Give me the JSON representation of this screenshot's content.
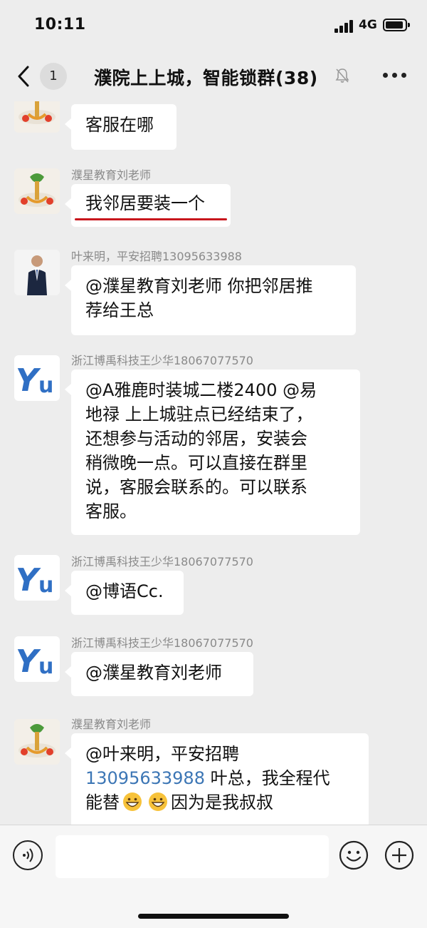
{
  "status_bar": {
    "time": "10:11",
    "network": "4G"
  },
  "nav": {
    "back_badge": "1",
    "title": "濮院上上城，智能锁群(38)",
    "icons": {
      "back": "chevron-left-icon",
      "mute": "bell-mute-icon",
      "more": "more-dots-icon"
    }
  },
  "messages": [
    {
      "sender": "",
      "text": "客服在哪",
      "avatar": "food-plate-avatar"
    },
    {
      "sender": "濮星教育刘老师",
      "text": "我邻居要装一个",
      "avatar": "food-plate-avatar",
      "underline_color": "#c8161d"
    },
    {
      "sender": "叶来明，平安招聘13095633988",
      "text": "@濮星教育刘老师 你把邻居推\n荐给王总",
      "avatar": "person-suit-avatar"
    },
    {
      "sender": "浙江博禹科技王少华18067077570",
      "text": "@A雅鹿时装城二楼2400 @易\n地禄 上上城驻点已经结束了，\n还想参与活动的邻居，安装会\n稍微晚一点。可以直接在群里\n说，客服会联系的。可以联系\n客服。",
      "avatar": "yu-logo-avatar"
    },
    {
      "sender": "浙江博禹科技王少华18067077570",
      "text": "@博语Cc.",
      "avatar": "yu-logo-avatar"
    },
    {
      "sender": "浙江博禹科技王少华18067077570",
      "text": "@濮星教育刘老师",
      "avatar": "yu-logo-avatar"
    },
    {
      "sender": "濮星教育刘老师",
      "avatar": "food-plate-avatar",
      "text_parts": {
        "line1": "@叶来明，平安招聘",
        "phone": "13095633988",
        "after_phone": " 叶总，我全程代",
        "line3_start": "能替",
        "line3_end": "因为是我叔叔"
      },
      "emoji": "grinning-face-icon",
      "link_color": "#3c76b5"
    }
  ],
  "input_bar": {
    "placeholder": "",
    "icons": {
      "voice": "voice-icon",
      "emoji": "emoji-icon",
      "plus": "plus-icon"
    }
  },
  "colors": {
    "background": "#ededed",
    "bubble": "#ffffff",
    "sender_text": "#8a8a8a",
    "accent_underline": "#c8161d"
  }
}
